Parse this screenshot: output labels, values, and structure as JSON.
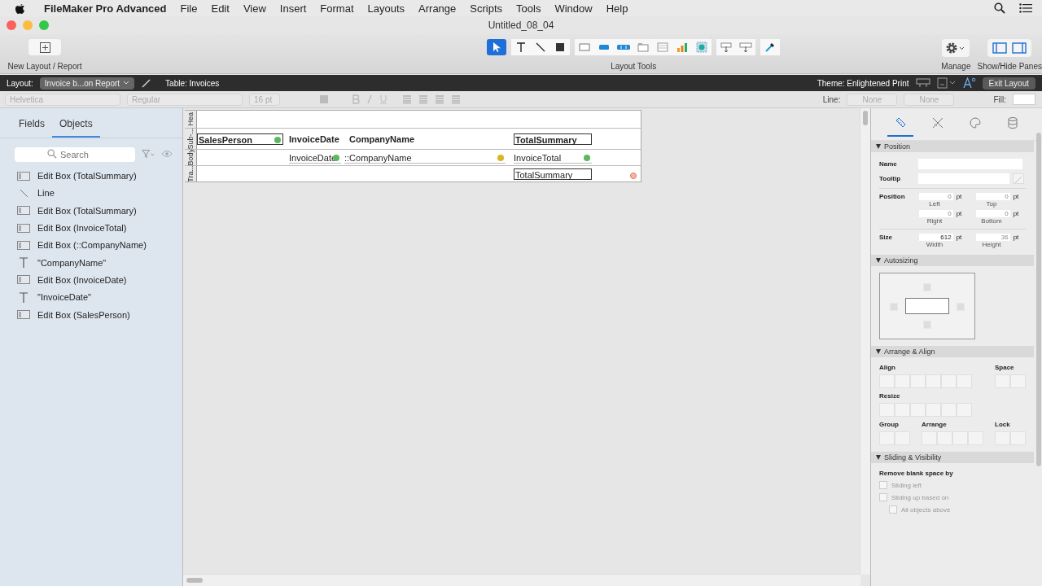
{
  "menubar": {
    "app": "FileMaker Pro Advanced",
    "menus": [
      "File",
      "Edit",
      "View",
      "Insert",
      "Format",
      "Layouts",
      "Arrange",
      "Scripts",
      "Tools",
      "Window",
      "Help"
    ]
  },
  "window": {
    "title": "Untitled_08_04"
  },
  "toolbar": {
    "new_layout": "New Layout / Report",
    "tools_label": "Layout Tools",
    "tools": [
      {
        "kind": "pointer",
        "selected": true
      },
      {
        "kind": "text",
        "selected": false
      },
      {
        "kind": "line",
        "selected": false
      },
      {
        "kind": "shape",
        "selected": false
      },
      {
        "kind": "field",
        "selected": false
      },
      {
        "kind": "button",
        "selected": false
      },
      {
        "kind": "buttonbar",
        "selected": false
      },
      {
        "kind": "tab",
        "selected": false
      },
      {
        "kind": "portal",
        "selected": false
      },
      {
        "kind": "chart",
        "selected": false
      },
      {
        "kind": "webviewer",
        "selected": false
      },
      {
        "kind": "insertfield",
        "selected": false
      },
      {
        "kind": "insertpart",
        "selected": false
      },
      {
        "kind": "painter",
        "selected": false
      }
    ],
    "manage": "Manage",
    "panes": "Show/Hide Panes"
  },
  "layout_bar": {
    "layout_label": "Layout:",
    "layout": "Invoice b...on Report",
    "table": "Table: Invoices",
    "theme": "Theme: Enlightened Print",
    "exit": "Exit Layout"
  },
  "format_bar": {
    "font": "Helvetica",
    "style": "Regular",
    "size": "16 pt",
    "line_label": "Line:",
    "line_styles": [
      "None",
      "None"
    ],
    "fill_label": "Fill:"
  },
  "left_pane": {
    "tabs": [
      {
        "label": "Fields",
        "selected": false
      },
      {
        "label": "Objects",
        "selected": true
      }
    ],
    "search": {
      "placeholder": "Search"
    },
    "objects": [
      {
        "kind": "edit_box",
        "label": "Edit Box (TotalSummary)"
      },
      {
        "kind": "line",
        "label": "Line"
      },
      {
        "kind": "edit_box",
        "label": "Edit Box (TotalSummary)"
      },
      {
        "kind": "edit_box",
        "label": "Edit Box (InvoiceTotal)"
      },
      {
        "kind": "edit_box",
        "label": "Edit Box (::CompanyName)"
      },
      {
        "kind": "text",
        "label": "\"CompanyName\""
      },
      {
        "kind": "edit_box",
        "label": "Edit Box (InvoiceDate)"
      },
      {
        "kind": "text",
        "label": "\"InvoiceDate\""
      },
      {
        "kind": "edit_box",
        "label": "Edit Box (SalesPerson)"
      }
    ]
  },
  "layout": {
    "parts": [
      {
        "label": "Hea"
      },
      {
        "label": "Sub-...",
        "objects": [
          {
            "kind": "field",
            "text": "SalesPerson",
            "bold": true,
            "color": "#5cb85c"
          },
          {
            "kind": "label",
            "text": "InvoiceDate",
            "bold": true
          },
          {
            "kind": "label",
            "text": "CompanyName",
            "bold": true
          },
          {
            "kind": "field",
            "text": "TotalSummary",
            "bold": true
          }
        ]
      },
      {
        "label": "Body",
        "objects": [
          {
            "kind": "plain",
            "text": "InvoiceDate",
            "bold": false,
            "color": "#5cb85c"
          },
          {
            "kind": "plain",
            "text": "::CompanyName",
            "bold": false,
            "color": "#d9b526"
          },
          {
            "kind": "plain",
            "text": "InvoiceTotal",
            "bold": false,
            "color": "#5cb85c"
          }
        ]
      },
      {
        "label": "Tra...",
        "objects": [
          {
            "kind": "field",
            "text": "TotalSummary",
            "bold": false
          }
        ]
      }
    ]
  },
  "inspector": {
    "tabs": [
      {
        "kind": "position",
        "selected": true
      },
      {
        "kind": "styles",
        "selected": false
      },
      {
        "kind": "appearance",
        "selected": false
      },
      {
        "kind": "data",
        "selected": false
      }
    ],
    "position": {
      "title": "Position",
      "name_label": "Name",
      "tooltip_label": "Tooltip",
      "position_label": "Position",
      "size_label": "Size",
      "position_fields": [
        {
          "label": "Left",
          "value": "0",
          "unit": "pt",
          "disabled": true
        },
        {
          "label": "Top",
          "value": "0",
          "unit": "pt",
          "disabled": true
        },
        {
          "label": "Right",
          "value": "0",
          "unit": "pt",
          "disabled": true
        },
        {
          "label": "Bottom",
          "value": "0",
          "unit": "pt",
          "disabled": true
        }
      ],
      "size_fields": [
        {
          "label": "Width",
          "value": "612",
          "unit": "pt",
          "disabled": false
        },
        {
          "label": "Height",
          "value": "36",
          "unit": "pt",
          "disabled": true
        }
      ]
    },
    "autosizing": {
      "title": "Autosizing"
    },
    "arrange": {
      "title": "Arrange & Align",
      "groups": [
        {
          "label": "Align"
        },
        {
          "label": "Space"
        },
        {
          "label": "Resize"
        },
        {
          "label": "Group"
        },
        {
          "label": "Arrange"
        },
        {
          "label": "Lock"
        }
      ]
    },
    "sliding": {
      "title": "Sliding & Visibility",
      "remove_label": "Remove blank space by",
      "options": [
        {
          "label": "Sliding left",
          "checked": false,
          "disabled": true
        },
        {
          "label": "Sliding up based on",
          "checked": false,
          "disabled": true
        },
        {
          "label": "All objects above",
          "checked": false,
          "disabled": true
        }
      ]
    }
  }
}
